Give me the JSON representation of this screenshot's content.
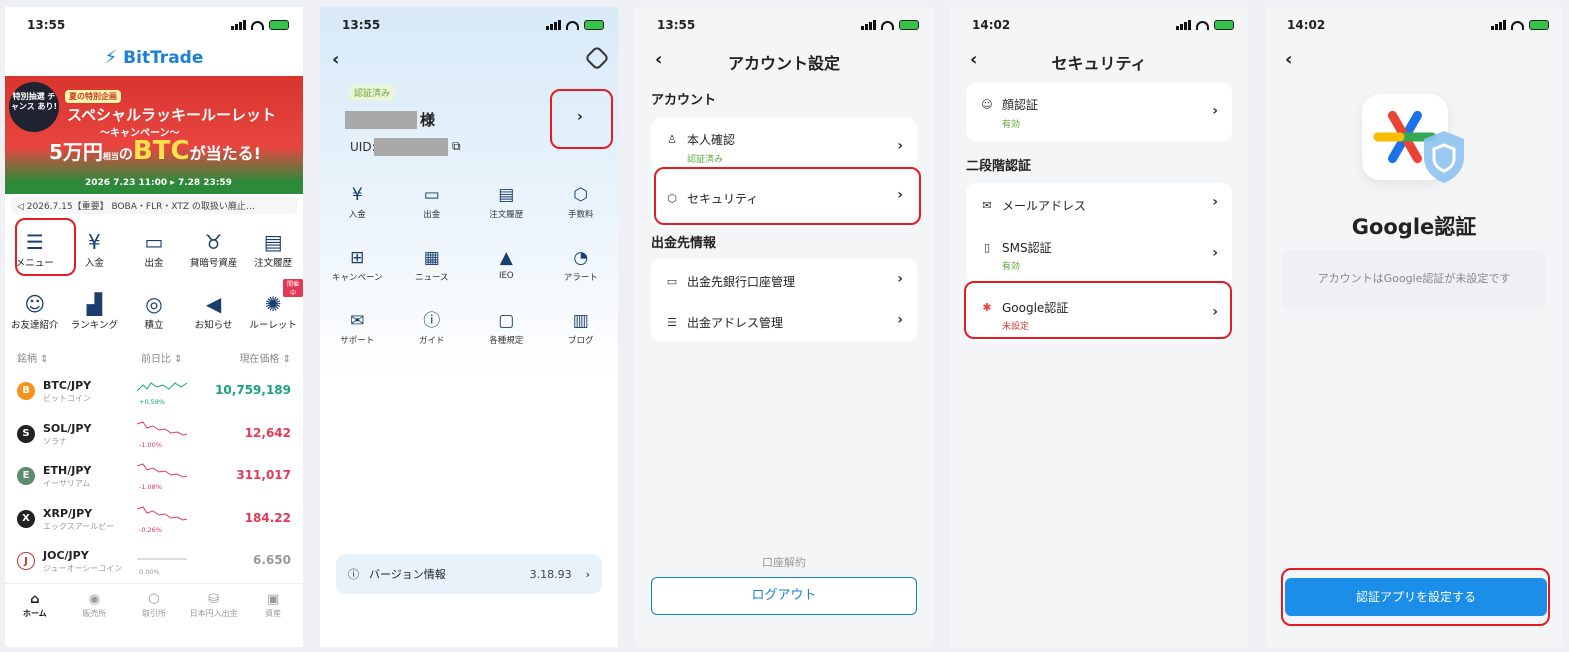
{
  "screens": [
    {
      "time": "13:55",
      "logo": "BitTrade",
      "banner": {
        "badge": "特別抽選 チャンス あり!",
        "tag": "夏の特別企画",
        "title": "スペシャルラッキールーレット",
        "subtitle": "〜キャンペーン〜",
        "prize_prefix": "5万円",
        "prize_small": "相当",
        "prize_mid": "の",
        "prize_asset": "BTC",
        "prize_suffix": "が当たる!",
        "dates": "2026 7.23 11:00 ▸ 7.28 23:59"
      },
      "ticker": "2026.7.15【重要】 BOBA・FLR・XTZ の取扱い廃止…",
      "menu_row1": [
        {
          "label": "メニュー",
          "icon": "menu-icon",
          "glyph": "☰"
        },
        {
          "label": "入金",
          "icon": "deposit-icon",
          "glyph": "¥"
        },
        {
          "label": "出金",
          "icon": "withdraw-icon",
          "glyph": "▭"
        },
        {
          "label": "貸暗号資産",
          "icon": "piggy-bank-icon",
          "glyph": "♉"
        },
        {
          "label": "注文履歴",
          "icon": "order-history-icon",
          "glyph": "▤"
        }
      ],
      "menu_row2": [
        {
          "label": "お友達紹介",
          "icon": "invite-friends-icon",
          "glyph": "☺"
        },
        {
          "label": "ランキング",
          "icon": "ranking-icon",
          "glyph": "▟"
        },
        {
          "label": "積立",
          "icon": "accumulate-icon",
          "glyph": "◎"
        },
        {
          "label": "お知らせ",
          "icon": "megaphone-icon",
          "glyph": "◀"
        },
        {
          "label": "ルーレット",
          "icon": "roulette-icon",
          "glyph": "✺",
          "badge": "開催中"
        }
      ],
      "table_headers": {
        "name": "銘柄 ⇕",
        "change": "前日比 ⇕",
        "price": "現在価格 ⇕"
      },
      "coins": [
        {
          "pair": "BTC/JPY",
          "name": "ビットコイン",
          "change": "+0.58%",
          "price": "10,759,189",
          "color": "#f7931a",
          "trend": "up"
        },
        {
          "pair": "SOL/JPY",
          "name": "ソラナ",
          "change": "-1.00%",
          "price": "12,642",
          "color": "#222",
          "trend": "down"
        },
        {
          "pair": "ETH/JPY",
          "name": "イーサリアム",
          "change": "-1.08%",
          "price": "311,017",
          "color": "#5f8a6f",
          "trend": "down"
        },
        {
          "pair": "XRP/JPY",
          "name": "エックスアールピー",
          "change": "-0.26%",
          "price": "184.22",
          "color": "#222",
          "trend": "down"
        },
        {
          "pair": "JOC/JPY",
          "name": "ジューオーシーコイン",
          "change": "0.00%",
          "price": "6.650",
          "color": "#fff",
          "trend": "flat"
        }
      ],
      "tabs": [
        {
          "label": "ホーム",
          "icon": "home-icon",
          "glyph": "⌂",
          "active": true
        },
        {
          "label": "販売所",
          "icon": "exchange-icon",
          "glyph": "◉"
        },
        {
          "label": "取引所",
          "icon": "trade-icon",
          "glyph": "⬡"
        },
        {
          "label": "日本円入出金",
          "icon": "jpy-transfer-icon",
          "glyph": "⛁"
        },
        {
          "label": "資産",
          "icon": "wallet-icon",
          "glyph": "▣"
        }
      ]
    },
    {
      "time": "13:55",
      "verified_badge": "認証済み",
      "username_suffix": "様",
      "uid_label": "UID:",
      "grid": [
        {
          "label": "入金",
          "icon": "deposit-icon",
          "glyph": "¥"
        },
        {
          "label": "出金",
          "icon": "withdraw-icon",
          "glyph": "▭"
        },
        {
          "label": "注文履歴",
          "icon": "order-history-icon",
          "glyph": "▤"
        },
        {
          "label": "手数料",
          "icon": "fee-icon",
          "glyph": "⬡"
        },
        {
          "label": "キャンペーン",
          "icon": "gift-icon",
          "glyph": "⊞"
        },
        {
          "label": "ニュース",
          "icon": "news-icon",
          "glyph": "▦"
        },
        {
          "label": "IEO",
          "icon": "rocket-icon",
          "glyph": "▲"
        },
        {
          "label": "アラート",
          "icon": "alert-bell-icon",
          "glyph": "◔"
        },
        {
          "label": "サポート",
          "icon": "support-chat-icon",
          "glyph": "✉"
        },
        {
          "label": "ガイド",
          "icon": "guide-icon",
          "glyph": "ⓘ"
        },
        {
          "label": "各種規定",
          "icon": "rules-icon",
          "glyph": "▢"
        },
        {
          "label": "ブログ",
          "icon": "blog-icon",
          "glyph": "▥"
        }
      ],
      "version_label": "バージョン情報",
      "version_value": "3.18.93"
    },
    {
      "time": "13:55",
      "title": "アカウント設定",
      "section_account": "アカウント",
      "identity_label": "本人確認",
      "identity_status": "認証済み",
      "security_label": "セキュリティ",
      "section_withdraw": "出金先情報",
      "bank_label": "出金先銀行口座管理",
      "address_label": "出金アドレス管理",
      "close_account": "口座解約",
      "logout": "ログアウト"
    },
    {
      "time": "14:02",
      "title": "セキュリティ",
      "face_label": "顔認証",
      "face_status": "有効",
      "section_2fa": "二段階認証",
      "email_label": "メールアドレス",
      "sms_label": "SMS認証",
      "sms_status": "有効",
      "google_label": "Google認証",
      "google_status": "未設定"
    },
    {
      "time": "14:02",
      "title": "Google認証",
      "message": "アカウントはGoogle認証が未設定です",
      "setup_button": "認証アプリを設定する"
    }
  ],
  "colors": {
    "accent": "#1a8ee8",
    "highlight": "#e51c23",
    "up": "#1aa37a",
    "down": "#e03a55"
  }
}
